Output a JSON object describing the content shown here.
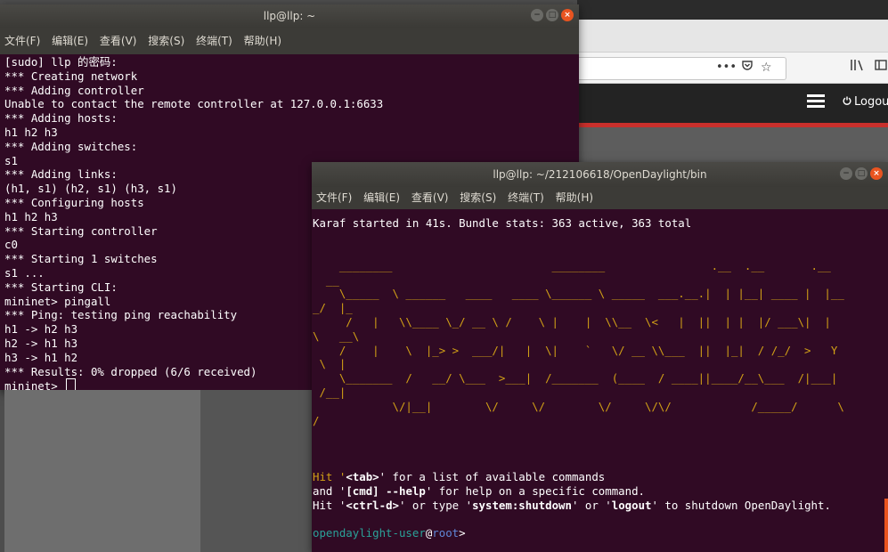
{
  "browser": {
    "toolbar_icons": [
      "more-icon",
      "pocket-icon",
      "star-icon",
      "library-icon",
      "sidebar-icon"
    ],
    "logout_label": "Logout"
  },
  "terminal1": {
    "title": "llp@llp: ~",
    "menu": [
      "文件(F)",
      "编辑(E)",
      "查看(V)",
      "搜索(S)",
      "终端(T)",
      "帮助(H)"
    ],
    "lines": [
      "[sudo] llp 的密码:",
      "*** Creating network",
      "*** Adding controller",
      "Unable to contact the remote controller at 127.0.0.1:6633",
      "*** Adding hosts:",
      "h1 h2 h3",
      "*** Adding switches:",
      "s1",
      "*** Adding links:",
      "(h1, s1) (h2, s1) (h3, s1)",
      "*** Configuring hosts",
      "h1 h2 h3",
      "*** Starting controller",
      "c0",
      "*** Starting 1 switches",
      "s1 ...",
      "*** Starting CLI:",
      "mininet> pingall",
      "*** Ping: testing ping reachability",
      "h1 -> h2 h3",
      "h2 -> h1 h3",
      "h3 -> h1 h2",
      "*** Results: 0% dropped (6/6 received)"
    ],
    "prompt": "mininet> "
  },
  "terminal2": {
    "title": "llp@llp: ~/212106618/OpenDaylight/bin",
    "menu": [
      "文件(F)",
      "编辑(E)",
      "查看(V)",
      "搜索(S)",
      "终端(T)",
      "帮助(H)"
    ],
    "karaf_line": "Karaf started in 41s. Bundle stats: 363 active, 363 total",
    "banner": [
      "    ________                        ________                .__  .__       .__",
      "  __",
      "    \\_____  \\ ______   ____   ____ \\______ \\ _____  ___.__.|  | |__| ____ |  |__",
      "_/  |_",
      "     /   |   \\\\____ \\_/ __ \\ /    \\ |    |  \\\\__  \\<   |  ||  | |  |/ ___\\|  |",
      "\\   __\\",
      "    /    |    \\  |_> >  ___/|   |  \\|    `   \\/ __ \\\\___  ||  |_|  / /_/  >   Y",
      " \\  |",
      "    \\_______  /   __/ \\___  >___|  /_______  (____  / ____||____/__\\___  /|___|",
      " /__|",
      "            \\/|__|        \\/     \\/        \\/     \\/\\/            /_____/      \\",
      "/"
    ],
    "help": {
      "l1_pre": "Hit '",
      "l1_key": "<tab>",
      "l1_post": "' for a list of available commands",
      "l2_pre": "and '",
      "l2_key": "[cmd] --help",
      "l2_post": "' for help on a specific command.",
      "l3_pre": "Hit '",
      "l3_key1": "<ctrl-d>",
      "l3_mid1": "' or type '",
      "l3_key2": "system:shutdown",
      "l3_mid2": "' or '",
      "l3_key3": "logout",
      "l3_post": "' to shutdown OpenDaylight."
    },
    "prompt_user": "opendaylight-user",
    "prompt_at": "@",
    "prompt_host": "root",
    "prompt_end": ">"
  }
}
